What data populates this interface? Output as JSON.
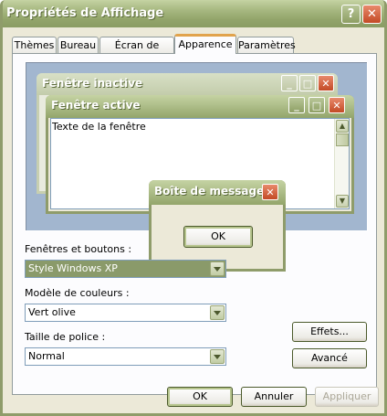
{
  "window": {
    "title": "Propriétés de Affichage",
    "help_label": "?",
    "close_label": "✕"
  },
  "tabs": [
    {
      "label": "Thèmes"
    },
    {
      "label": "Bureau"
    },
    {
      "label": "Écran de veille"
    },
    {
      "label": "Apparence",
      "active": true
    },
    {
      "label": "Paramètres"
    }
  ],
  "preview": {
    "inactive_title": "Fenêtre inactive",
    "active_title": "Fenêtre active",
    "window_text": "Texte de la fenêtre",
    "message_title": "Boîte de message",
    "ok_label": "OK"
  },
  "form": {
    "windows_buttons_label": "Fenêtres et boutons :",
    "windows_buttons_value": "Style Windows XP",
    "color_scheme_label": "Modèle de couleurs :",
    "color_scheme_value": "Vert olive",
    "font_size_label": "Taille de police :",
    "font_size_value": "Normal",
    "effects_label": "Effets...",
    "advanced_label": "Avancé"
  },
  "footer": {
    "ok_label": "OK",
    "cancel_label": "Annuler",
    "apply_label": "Appliquer"
  },
  "colors": {
    "title_bar": "#93a56b",
    "close_button": "#c34a25",
    "preview_background": "#a2b6cf",
    "active_tab_accent": "#e1a34c"
  },
  "icons": [
    "help-icon",
    "close-icon",
    "minimize-icon",
    "maximize-icon",
    "scroll-up-icon",
    "scroll-down-icon",
    "dropdown-arrow-icon"
  ]
}
